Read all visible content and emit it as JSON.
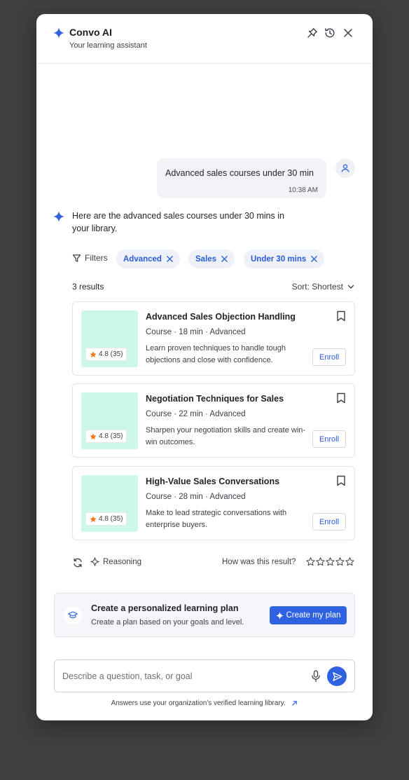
{
  "header": {
    "title": "Convo AI",
    "subtitle": "Your learning assistant",
    "icons": [
      "pin-icon",
      "history-icon",
      "close-icon"
    ]
  },
  "conversation": {
    "user_message": "Advanced sales courses under 30 min",
    "user_time": "10:38 AM",
    "ai_message": "Here are the advanced sales courses under 30 mins in your library."
  },
  "filters": {
    "label": "Filters",
    "chips": [
      "Advanced",
      "Sales",
      "Under 30 mins"
    ]
  },
  "results": {
    "count_label": "3 results",
    "sort_label": "Sort: Shortest"
  },
  "courses": [
    {
      "title": "Advanced Sales Objection Handling",
      "meta": "Course · 18 min · Advanced",
      "description": "Learn proven techniques to handle tough objections and close with confidence.",
      "rating": "4.8 (35)",
      "enroll_label": "Enroll"
    },
    {
      "title": "Negotiation Techniques for Sales",
      "meta": "Course · 22 min · Advanced",
      "description": "Sharpen your negotiation skills and create win-win outcomes.",
      "rating": "4.8 (35)",
      "enroll_label": "Enroll"
    },
    {
      "title": "High-Value Sales Conversations",
      "meta": "Course · 28 min · Advanced",
      "description": "Make to lead strategic conversations with enterprise buyers.",
      "rating": "4.8 (35)",
      "enroll_label": "Enroll"
    }
  ],
  "feedback": {
    "reasoning_label": "Reasoning",
    "question": "How was this result?",
    "stars_selected": 0,
    "stars_total": 5
  },
  "plan": {
    "title": "Create a personalized learning plan",
    "subtitle": "Create a plan based on your goals and level.",
    "button_label": "Create my plan"
  },
  "composer": {
    "placeholder": "Describe a question, task, or goal",
    "value": ""
  },
  "footnote": "Answers use your organization's verified learning library.",
  "colors": {
    "accent": "#2f62e0",
    "chip_text": "#2b5bd7",
    "thumb": "#cdf7ea",
    "star": "#f07a1a",
    "backdrop": "#3f3f3f"
  }
}
